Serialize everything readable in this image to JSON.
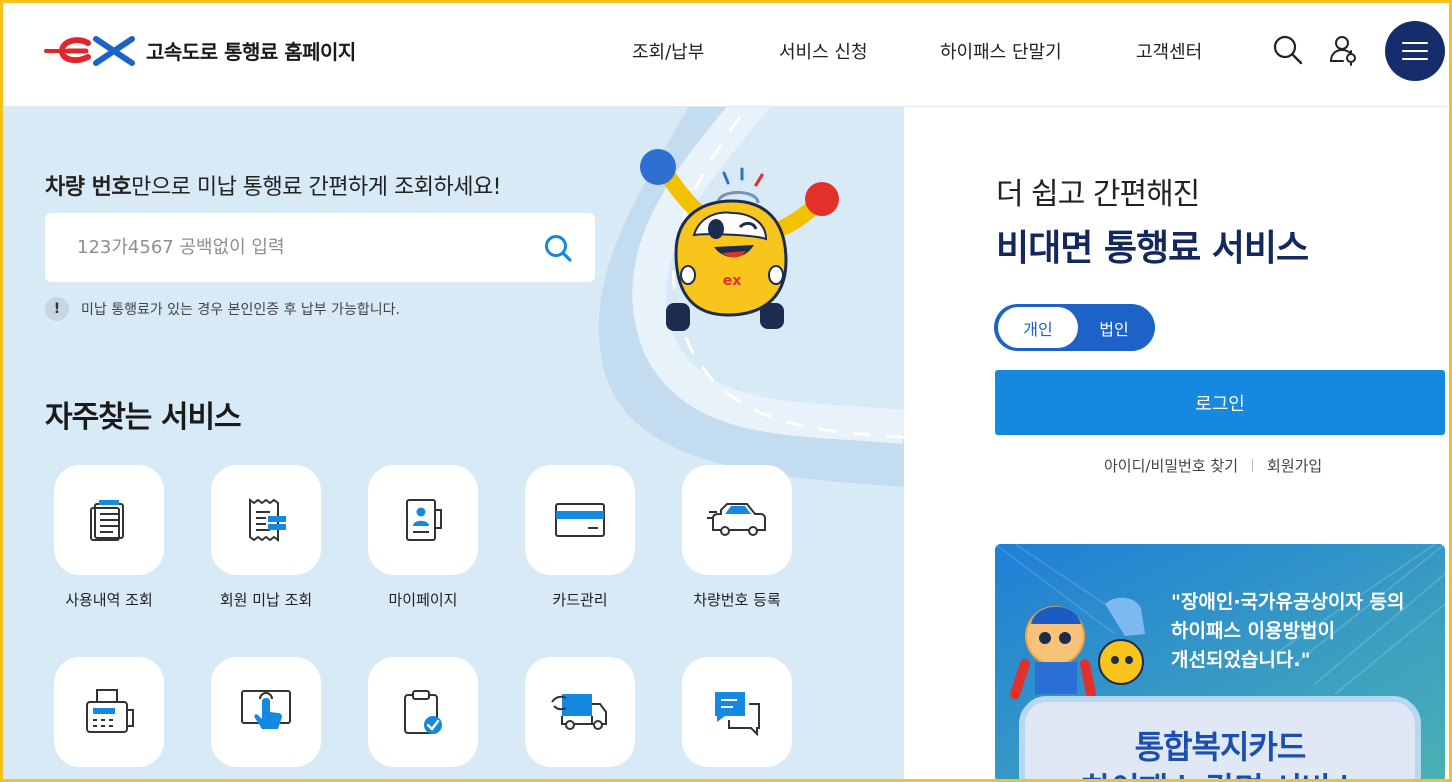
{
  "header": {
    "logo_mark_text": "ex",
    "logo_text": "고속도로 통행료 홈페이지",
    "nav": [
      "조회/납부",
      "서비스 신청",
      "하이패스 단말기",
      "고객센터"
    ],
    "icons": [
      "search-icon",
      "user-icon",
      "menu-icon"
    ]
  },
  "left": {
    "lead_bold": "차량 번호",
    "lead_rest": "만으로 미납 통행료 간편하게 조회하세요!",
    "search_placeholder": "123가4567 공백없이 입력",
    "notice_badge": "!",
    "notice": "미납 통행료가 있는 경우 본인인증 후 납부 가능합니다.",
    "mascot_logo": "ex",
    "section_title": "자주찾는 서비스",
    "services": [
      {
        "label": "사용내역 조회",
        "icon": "document-list-icon"
      },
      {
        "label": "회원 미납 조회",
        "icon": "receipt-icon"
      },
      {
        "label": "마이페이지",
        "icon": "profile-book-icon"
      },
      {
        "label": "카드관리",
        "icon": "card-icon"
      },
      {
        "label": "차량번호 등록",
        "icon": "car-icon"
      },
      {
        "label": "",
        "icon": "fax-icon"
      },
      {
        "label": "",
        "icon": "touch-screen-icon"
      },
      {
        "label": "",
        "icon": "clipboard-check-icon"
      },
      {
        "label": "",
        "icon": "truck-icon"
      },
      {
        "label": "",
        "icon": "chat-icon"
      }
    ]
  },
  "right": {
    "subtitle": "더 쉽고 간편해진",
    "title": "비대면 통행료 서비스",
    "toggle": {
      "on": "개인",
      "off": "법인"
    },
    "login": "로그인",
    "find_id": "아이디/비밀번호 찾기",
    "join": "회원가입",
    "banner": {
      "quote": "\"장애인·국가유공상이자 등의\n하이패스 이용방법이\n개선되었습니다.\"",
      "card_title": "통합복지카드",
      "card_sub": "하이패스 감면 서비스"
    }
  },
  "colors": {
    "brand_navy": "#162d6b",
    "brand_red": "#e0262b",
    "brand_blue": "#1589e0",
    "highlight_yellow": "#f4c21a",
    "left_bg": "#d8eaf6"
  }
}
